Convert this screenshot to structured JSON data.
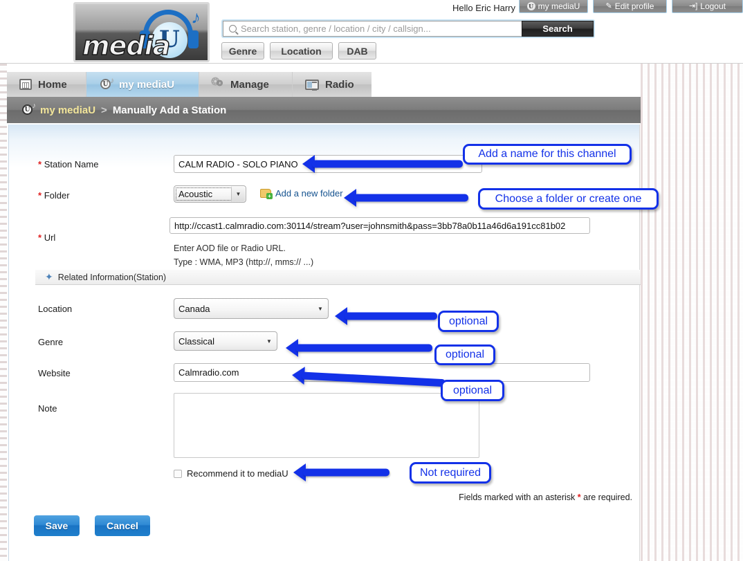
{
  "header": {
    "greeting": "Hello Eric Harry",
    "buttons": [
      {
        "label": "my mediaU",
        "icon": "u-badge-icon"
      },
      {
        "label": "Edit profile",
        "icon": "pencil-icon"
      },
      {
        "label": "Logout",
        "icon": "logout-icon"
      }
    ],
    "logo": {
      "word": "media",
      "letter": "U",
      "note": "♪"
    },
    "search": {
      "placeholder": "Search station, genre / location / city / callsign...",
      "value": "",
      "button_label": "Search",
      "icon": "search-icon"
    },
    "quick_buttons": [
      {
        "label": "Genre"
      },
      {
        "label": "Location"
      },
      {
        "label": "DAB"
      }
    ]
  },
  "nav": {
    "tabs": [
      {
        "label": "Home",
        "icon": "home-icon",
        "active": false
      },
      {
        "label": "my mediaU",
        "icon": "u-badge-icon",
        "active": true
      },
      {
        "label": "Manage",
        "icon": "gear-icon",
        "active": false
      },
      {
        "label": "Radio",
        "icon": "radio-icon",
        "active": false
      }
    ]
  },
  "breadcrumb": {
    "icon": "u-badge-icon",
    "root": "my mediaU",
    "separator": ">",
    "current": "Manually Add a Station"
  },
  "form": {
    "station_name": {
      "label": "Station Name",
      "required_mark": "*",
      "value": "CALM RADIO - SOLO PIANO"
    },
    "folder": {
      "label": "Folder",
      "required_mark": "*",
      "selected": "Acoustic",
      "add_link": "Add a new folder",
      "add_link_icon": "folder-add-icon"
    },
    "url": {
      "label": "Url",
      "required_mark": "*",
      "value": "http://ccast1.calmradio.com:30114/stream?user=johnsmith&pass=3bb78a0b11a46d6a191cc81b02",
      "hint_line1": "Enter AOD file or Radio URL.",
      "hint_line2": "Type : WMA, MP3 (http://, mms:// ...)"
    },
    "related_section": {
      "icon": "blue-star-icon",
      "title": "Related Information(Station)"
    },
    "location": {
      "label": "Location",
      "selected": "Canada"
    },
    "genre": {
      "label": "Genre",
      "selected": "Classical"
    },
    "website": {
      "label": "Website",
      "value": "Calmradio.com"
    },
    "note": {
      "label": "Note",
      "value": ""
    },
    "recommend": {
      "label": "Recommend it to mediaU",
      "checked": false
    },
    "asterisk_note_pre": "Fields marked with an asterisk ",
    "asterisk_note_mark": "*",
    "asterisk_note_post": " are required.",
    "save_label": "Save",
    "cancel_label": "Cancel"
  },
  "annotations": [
    {
      "text": "Add a name for this channel"
    },
    {
      "text": "Choose a folder or create one"
    },
    {
      "text": "optional"
    },
    {
      "text": "optional"
    },
    {
      "text": "optional"
    },
    {
      "text": "Not required"
    }
  ],
  "colors": {
    "annotation_blue": "#1331e8",
    "required_red": "#e02020",
    "tab_active_blue": "#a9cfe8",
    "button_blue": "#1f7fcc",
    "crumb_yellow": "#f2e59a"
  }
}
